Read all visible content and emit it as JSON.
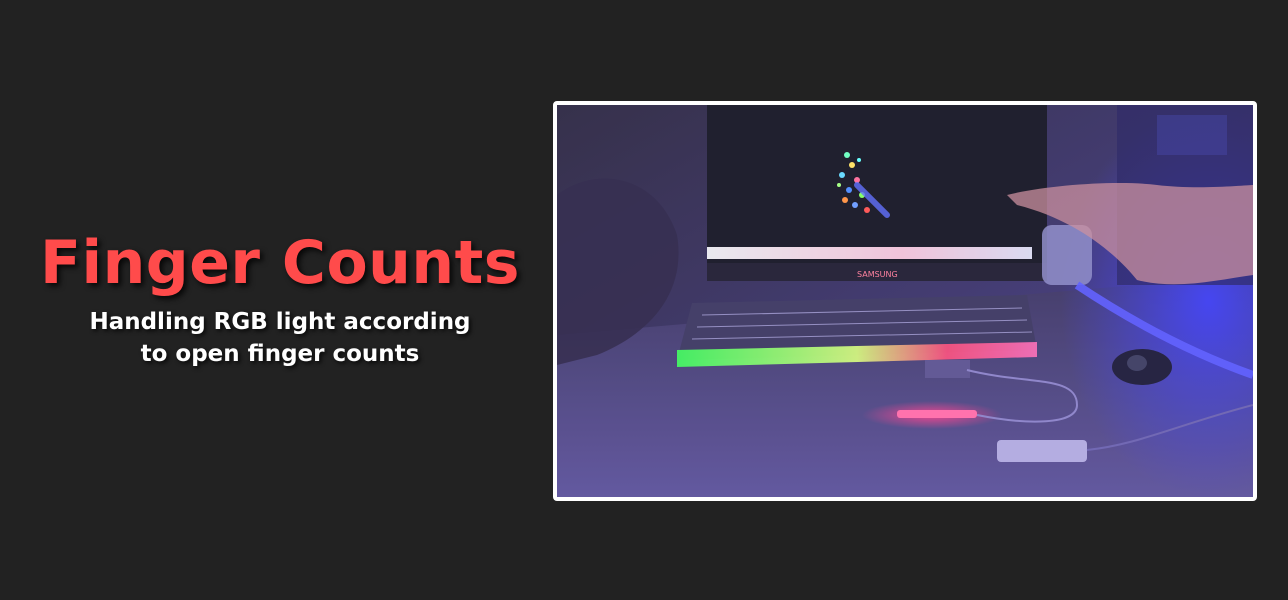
{
  "header": {
    "title": "Finger Counts",
    "subtitle_line1": "Handling RGB light according",
    "subtitle_line2": "to open finger counts"
  },
  "photo": {
    "monitor_brand": "SAMSUNG"
  },
  "colors": {
    "background": "#222222",
    "title": "#ff4b4b",
    "subtitle": "#ffffff",
    "frame_border": "#ffffff"
  }
}
